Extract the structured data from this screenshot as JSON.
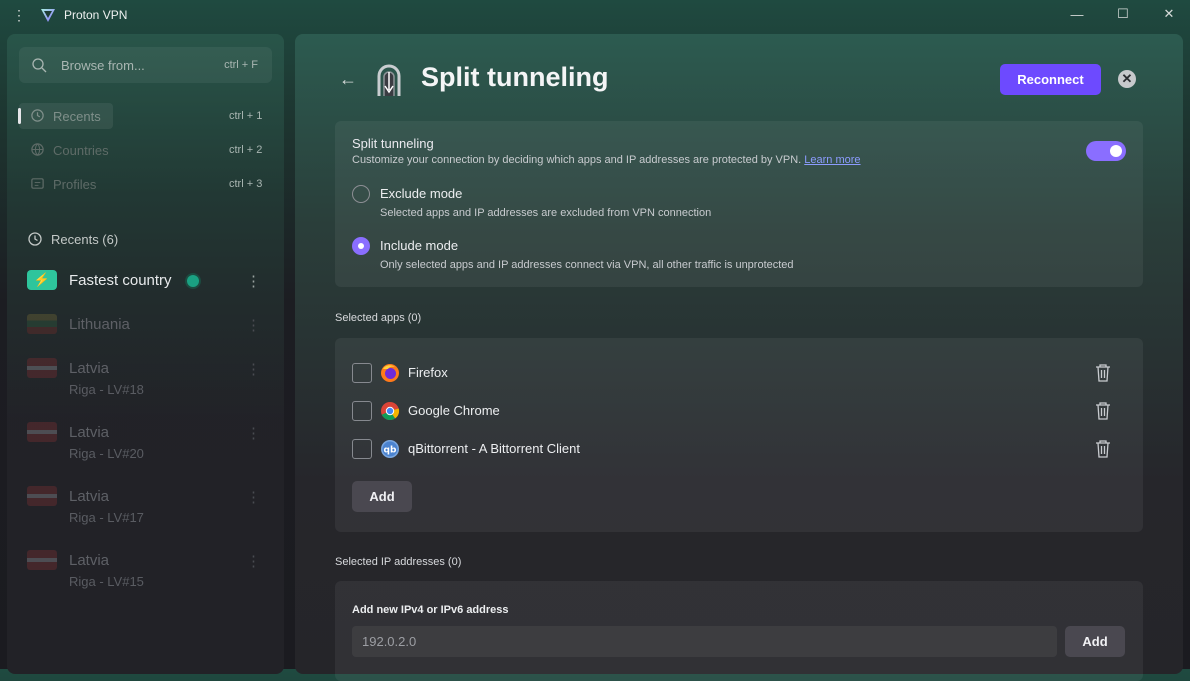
{
  "titlebar": {
    "title": "Proton VPN",
    "menu_glyph": "⋮",
    "logo_icon": "proton-vpn-logo",
    "minimize_glyph": "—",
    "maximize_glyph": "☐",
    "close_glyph": "✕"
  },
  "sidebar": {
    "search": {
      "placeholder": "Browse from...",
      "shortcut": "ctrl + F"
    },
    "nav": [
      {
        "label": "Recents",
        "shortcut": "ctrl + 1",
        "icon": "history-icon",
        "active": true
      },
      {
        "label": "Countries",
        "shortcut": "ctrl + 2",
        "icon": "globe-icon",
        "active": false
      },
      {
        "label": "Profiles",
        "shortcut": "ctrl + 3",
        "icon": "profile-icon",
        "active": false
      }
    ],
    "recents_header": "Recents (6)",
    "recents": [
      {
        "name": "Fastest country",
        "sub": "",
        "type": "fastest"
      },
      {
        "name": "Lithuania",
        "sub": "",
        "flag": "lt"
      },
      {
        "name": "Latvia",
        "sub": "Riga - LV#18",
        "flag": "lv"
      },
      {
        "name": "Latvia",
        "sub": "Riga - LV#20",
        "flag": "lv"
      },
      {
        "name": "Latvia",
        "sub": "Riga - LV#17",
        "flag": "lv"
      },
      {
        "name": "Latvia",
        "sub": "Riga - LV#15",
        "flag": "lv"
      }
    ],
    "more_glyph": "⋮"
  },
  "main": {
    "back_glyph": "←",
    "title": "Split tunneling",
    "reconnect_label": "Reconnect",
    "close_glyph": "✕",
    "split": {
      "title": "Split tunneling",
      "description": "Customize your connection by deciding which apps and IP addresses are protected by VPN.",
      "learn_more": "Learn more",
      "enabled": true,
      "modes": [
        {
          "label": "Exclude mode",
          "desc": "Selected apps and IP addresses are excluded from VPN connection",
          "selected": false
        },
        {
          "label": "Include mode",
          "desc": "Only selected apps and IP addresses connect via VPN, all other traffic is unprotected",
          "selected": true
        }
      ]
    },
    "apps": {
      "header": "Selected apps (0)",
      "items": [
        {
          "name": "Firefox",
          "icon": "firefox-icon"
        },
        {
          "name": "Google Chrome",
          "icon": "chrome-icon"
        },
        {
          "name": "qBittorrent - A Bittorrent Client",
          "icon": "qbittorrent-icon"
        }
      ],
      "add_label": "Add"
    },
    "ips": {
      "header": "Selected IP addresses (0)",
      "input_label": "Add new IPv4 or IPv6 address",
      "placeholder": "192.0.2.0",
      "add_label": "Add"
    }
  },
  "colors": {
    "accent": "#6d4aff",
    "toggle": "#8a6eff",
    "fastest": "#2ec59c",
    "link": "#8c9cff"
  }
}
